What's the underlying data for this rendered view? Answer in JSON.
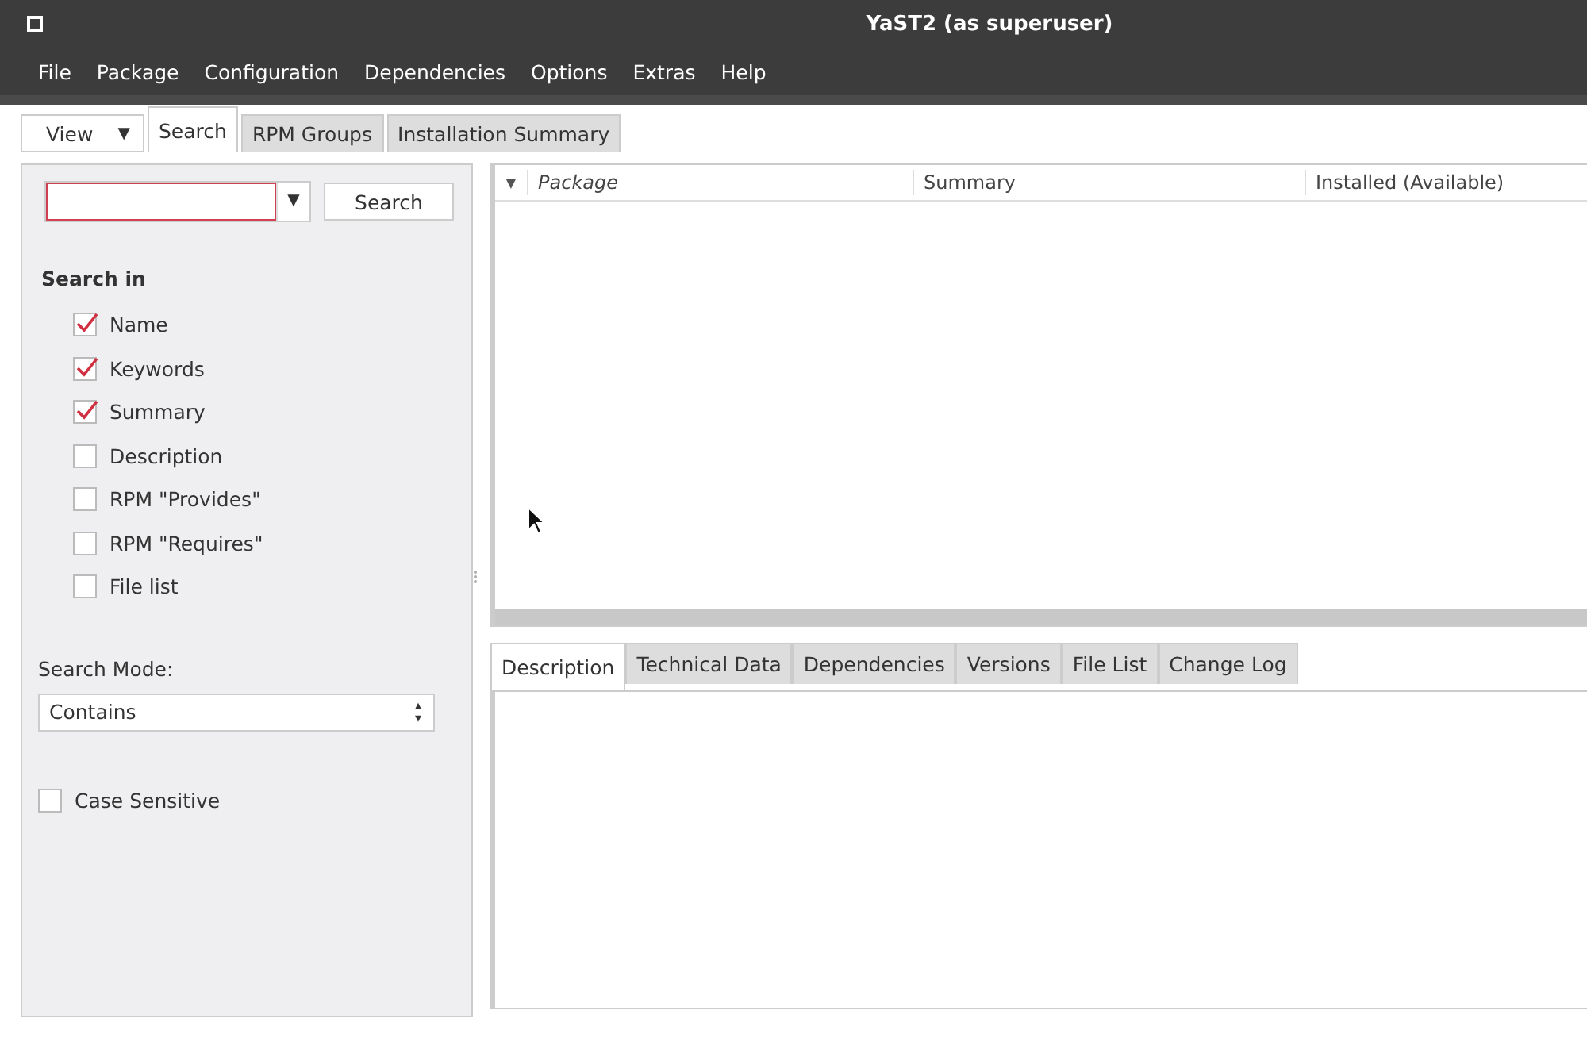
{
  "window": {
    "title": "YaST2 (as superuser)"
  },
  "menu": [
    "File",
    "Package",
    "Configuration",
    "Dependencies",
    "Options",
    "Extras",
    "Help"
  ],
  "view_button": {
    "label": "View",
    "caret": "▼"
  },
  "tabs": [
    {
      "label": "Search",
      "selected": true
    },
    {
      "label": "RPM Groups",
      "selected": false
    },
    {
      "label": "Installation Summary",
      "selected": false
    }
  ],
  "search": {
    "caret": "▼",
    "button": "Search",
    "heading": "Search in",
    "options": [
      {
        "label": "Name",
        "checked": true
      },
      {
        "label": "Keywords",
        "checked": true
      },
      {
        "label": "Summary",
        "checked": true
      },
      {
        "label": "Description",
        "checked": false
      },
      {
        "label": "RPM \"Provides\"",
        "checked": false
      },
      {
        "label": "RPM \"Requires\"",
        "checked": false
      },
      {
        "label": "File list",
        "checked": false
      }
    ],
    "mode_label": "Search Mode:",
    "mode_value": "Contains",
    "mode_arrows": "▴▾",
    "case_sensitive": {
      "label": "Case Sensitive",
      "checked": false
    }
  },
  "table": {
    "sort_mark": "▼",
    "columns": [
      "Package",
      "Summary",
      "Installed (Available)"
    ]
  },
  "detail_tabs": [
    {
      "label": "Description",
      "selected": true
    },
    {
      "label": "Technical Data",
      "selected": false
    },
    {
      "label": "Dependencies",
      "selected": false
    },
    {
      "label": "Versions",
      "selected": false
    },
    {
      "label": "File List",
      "selected": false
    },
    {
      "label": "Change Log",
      "selected": false
    }
  ]
}
